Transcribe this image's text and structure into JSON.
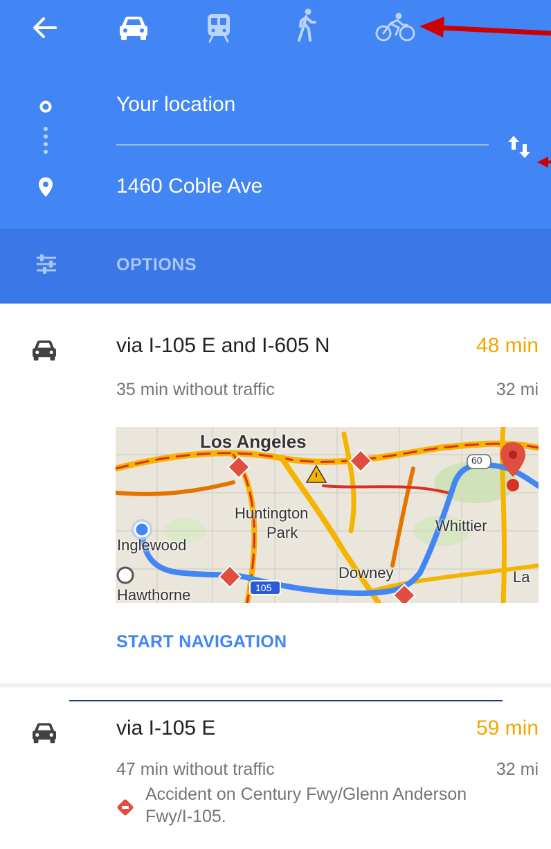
{
  "header": {
    "origin": "Your location",
    "destination": "1460 Coble Ave"
  },
  "options": {
    "label": "OPTIONS"
  },
  "routes": [
    {
      "title": "via I-105 E and I-605 N",
      "time": "48 min",
      "subtitle": "35 min without traffic",
      "distance": "32 mi",
      "action": "START NAVIGATION",
      "map_labels": [
        "Los Angeles",
        "Huntington",
        "Park",
        "Whittier",
        "Inglewood",
        "Downey",
        "Hawthorne",
        "La",
        "60",
        "105"
      ]
    },
    {
      "title": "via I-105 E",
      "time": "59 min",
      "subtitle": "47 min without traffic",
      "distance": "32 mi",
      "alert": "Accident on Century Fwy/Glenn Anderson Fwy/I-105."
    }
  ],
  "icons": {
    "back": "arrow-left-icon",
    "car": "car-icon",
    "transit": "train-icon",
    "walk": "walk-icon",
    "bike": "bicycle-icon",
    "swap": "swap-icon",
    "origin": "origin-dot-icon",
    "destination": "pin-icon",
    "options": "sliders-icon",
    "alert": "accident-icon"
  },
  "colors": {
    "header": "#4285f4",
    "options_bar": "#3b78e7",
    "delay": "#f2a600",
    "link": "#4285f4",
    "annotation_arrow": "#cc0000"
  }
}
